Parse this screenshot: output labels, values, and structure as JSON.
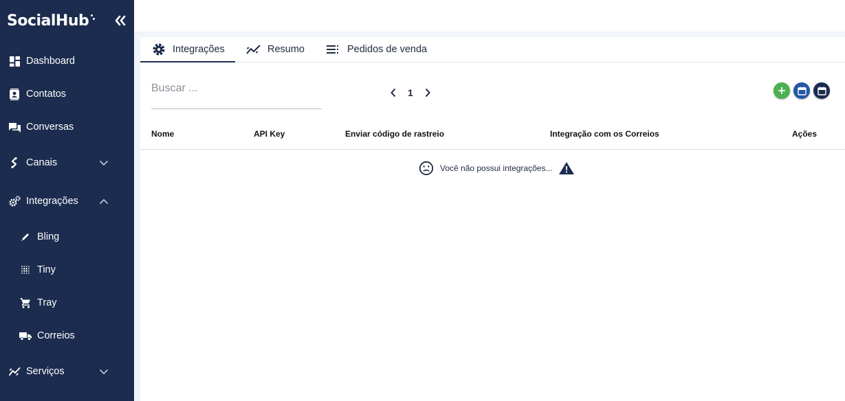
{
  "brand": {
    "name": "SocialHub"
  },
  "sidebar": {
    "items": [
      {
        "label": "Dashboard",
        "icon": "dashboard-icon"
      },
      {
        "label": "Contatos",
        "icon": "contacts-icon"
      },
      {
        "label": "Conversas",
        "icon": "chat-icon"
      },
      {
        "label": "Canais",
        "icon": "channels-icon",
        "expanded": false
      },
      {
        "label": "Integrações",
        "icon": "integrations-icon",
        "expanded": true
      },
      {
        "label": "Bling",
        "icon": "pen-icon",
        "sub": true
      },
      {
        "label": "Tiny",
        "icon": "grid-dots-icon",
        "sub": true
      },
      {
        "label": "Tray",
        "icon": "cart-icon",
        "sub": true
      },
      {
        "label": "Correios",
        "icon": "truck-icon",
        "sub": true
      },
      {
        "label": "Serviços",
        "icon": "services-icon",
        "expanded": false
      }
    ]
  },
  "tabs": [
    {
      "label": "Integrações",
      "icon": "gear-icon",
      "active": true
    },
    {
      "label": "Resumo",
      "icon": "trend-icon",
      "active": false
    },
    {
      "label": "Pedidos de venda",
      "icon": "list-icon",
      "active": false
    }
  ],
  "search": {
    "placeholder": "Buscar ...",
    "value": ""
  },
  "pagination": {
    "current_page": "1"
  },
  "actions": [
    {
      "name": "add-button",
      "color": "#4caf50"
    },
    {
      "name": "calendar-button",
      "color": "#2358a6"
    },
    {
      "name": "calendar-button-dark",
      "color": "#1b2c4e"
    }
  ],
  "table": {
    "columns": [
      "Nome",
      "API Key",
      "Enviar código de rastreio",
      "Integração com os Correios",
      "Ações"
    ],
    "rows": [],
    "empty_message": "Você não possui integrações..."
  },
  "colors": {
    "sidebar_bg": "#1b2c4e",
    "accent_green": "#4caf50",
    "accent_blue": "#2358a6"
  }
}
